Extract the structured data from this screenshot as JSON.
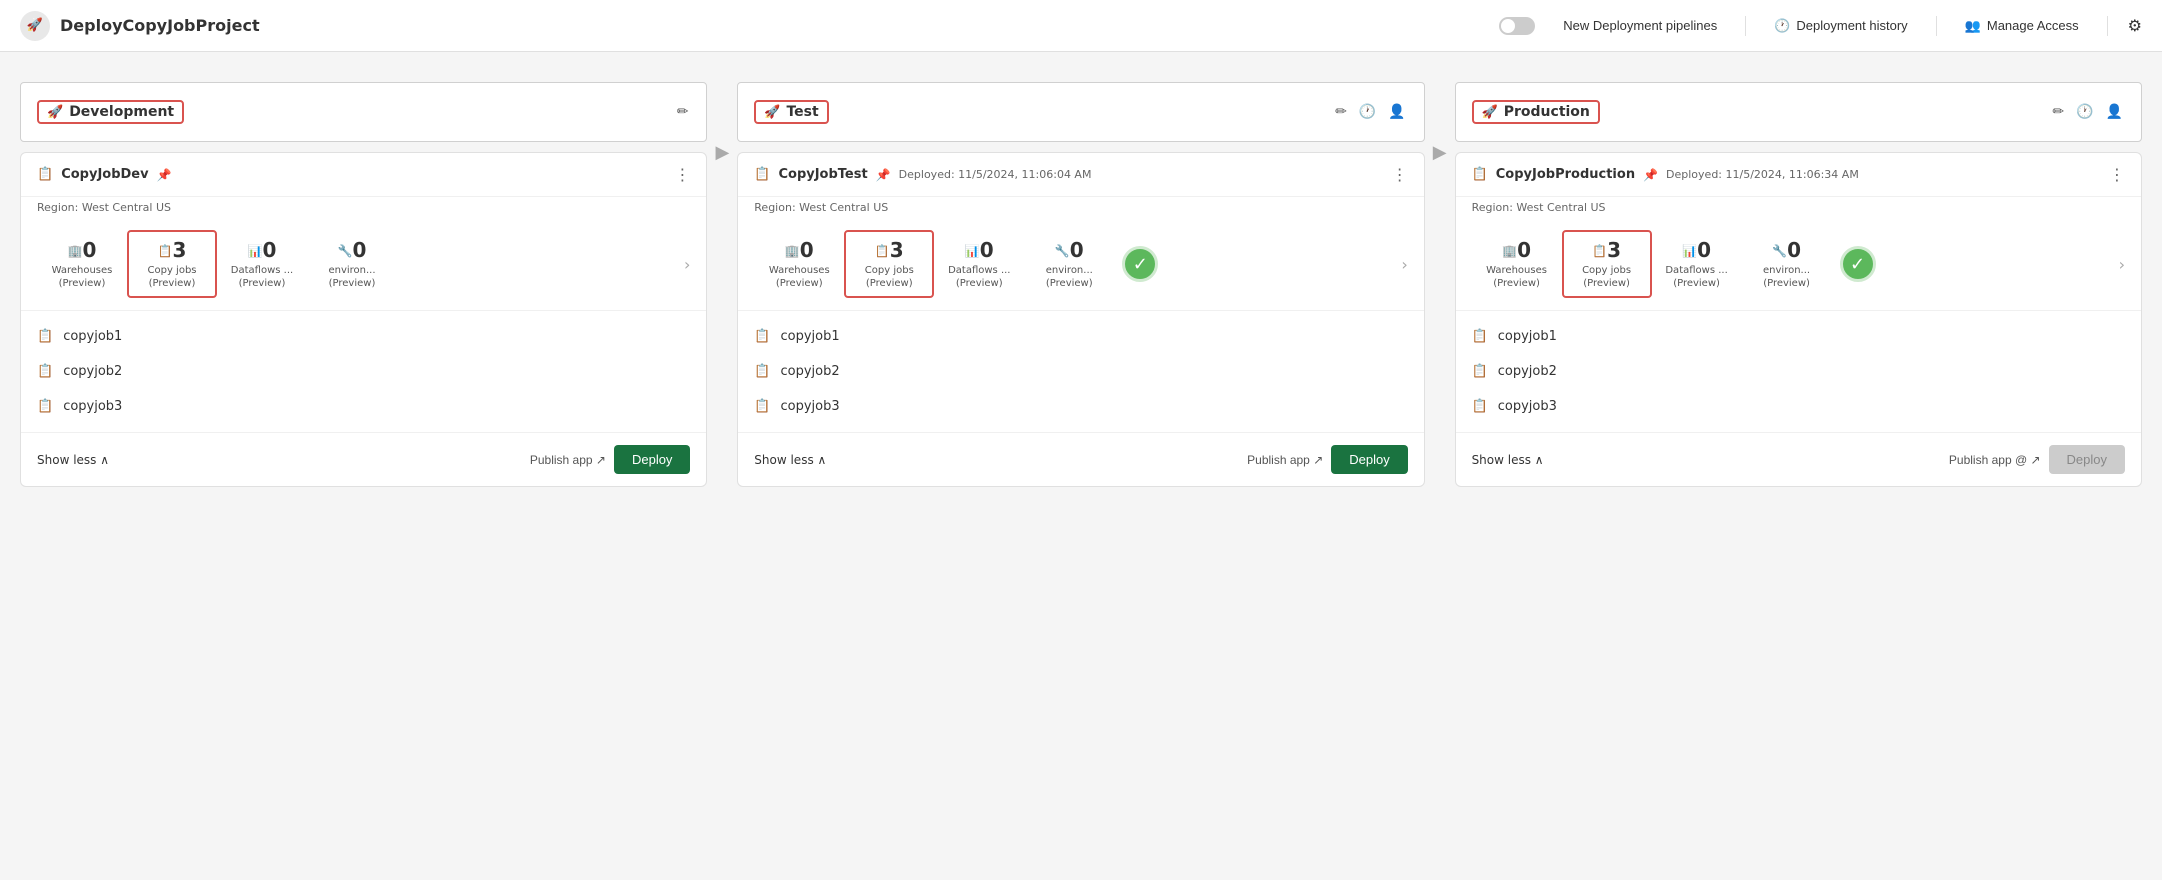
{
  "header": {
    "logo_icon": "rocket-icon",
    "title": "DeployCopyJobProject",
    "toggle_label": "New Deployment pipelines",
    "deployment_history_label": "Deployment history",
    "manage_access_label": "Manage Access",
    "settings_icon": "gear-icon"
  },
  "stages": [
    {
      "id": "development",
      "name": "Development",
      "outlined": true,
      "header_icons": [
        "edit-icon"
      ],
      "card": {
        "title": "CopyJobDev",
        "has_pin": true,
        "deployed_text": "",
        "region": "Region: West Central US",
        "metrics": [
          {
            "icon": "warehouse-icon",
            "count": "0",
            "label": "Warehouses\n(Preview)",
            "outlined": false
          },
          {
            "icon": "copy-icon",
            "count": "3",
            "label": "Copy jobs\n(Preview)",
            "outlined": true
          },
          {
            "icon": "dataflow-icon",
            "count": "0",
            "label": "Dataflows ...\n(Preview)",
            "outlined": false
          },
          {
            "icon": "env-icon",
            "count": "0",
            "label": "environ...\n(Preview)",
            "outlined": false
          }
        ],
        "has_success": false,
        "items": [
          "copyjob1",
          "copyjob2",
          "copyjob3"
        ],
        "show_less": true,
        "publish_label": "Publish app",
        "deploy_label": "Deploy",
        "deploy_disabled": false
      }
    },
    {
      "id": "test",
      "name": "Test",
      "outlined": true,
      "header_icons": [
        "edit-icon",
        "history-icon",
        "users-icon"
      ],
      "card": {
        "title": "CopyJobTest",
        "has_pin": true,
        "deployed_text": "Deployed: 11/5/2024, 11:06:04 AM",
        "region": "Region: West Central US",
        "metrics": [
          {
            "icon": "warehouse-icon",
            "count": "0",
            "label": "Warehouses\n(Preview)",
            "outlined": false
          },
          {
            "icon": "copy-icon",
            "count": "3",
            "label": "Copy jobs\n(Preview)",
            "outlined": true
          },
          {
            "icon": "dataflow-icon",
            "count": "0",
            "label": "Dataflows ...\n(Preview)",
            "outlined": false
          },
          {
            "icon": "env-icon",
            "count": "0",
            "label": "environ...\n(Preview)",
            "outlined": false
          }
        ],
        "has_success": true,
        "items": [
          "copyjob1",
          "copyjob2",
          "copyjob3"
        ],
        "show_less": true,
        "publish_label": "Publish app",
        "deploy_label": "Deploy",
        "deploy_disabled": false
      }
    },
    {
      "id": "production",
      "name": "Production",
      "outlined": true,
      "header_icons": [
        "edit-icon",
        "history-icon",
        "users-icon"
      ],
      "card": {
        "title": "CopyJobProduction",
        "has_pin": true,
        "deployed_text": "Deployed: 11/5/2024, 11:06:34 AM",
        "region": "Region: West Central US",
        "metrics": [
          {
            "icon": "warehouse-icon",
            "count": "0",
            "label": "Warehouses\n(Preview)",
            "outlined": false
          },
          {
            "icon": "copy-icon",
            "count": "3",
            "label": "Copy jobs\n(Preview)",
            "outlined": true
          },
          {
            "icon": "dataflow-icon",
            "count": "0",
            "label": "Dataflows ...\n(Preview)",
            "outlined": false
          },
          {
            "icon": "env-icon",
            "count": "0",
            "label": "environ...\n(Preview)",
            "outlined": false
          }
        ],
        "has_success": true,
        "items": [
          "copyjob1",
          "copyjob2",
          "copyjob3"
        ],
        "show_less": true,
        "publish_label": "Publish app @",
        "deploy_label": "Deploy",
        "deploy_disabled": true
      }
    }
  ],
  "arrow": "▶"
}
